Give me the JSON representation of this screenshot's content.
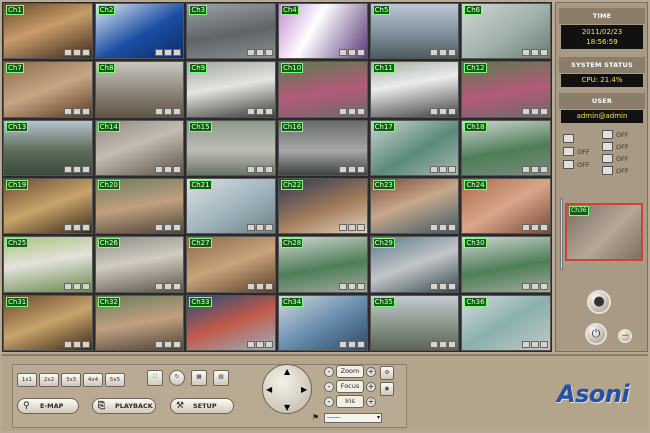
{
  "cameras": [
    {
      "label": "Ch1",
      "bg": "linear-gradient(160deg,#6a4a2a,#c99c6a 45%,#3b2a1a)"
    },
    {
      "label": "Ch2",
      "bg": "linear-gradient(150deg,#dfe8f0,#1b4ea3 55%,#0c2b66)"
    },
    {
      "label": "Ch3",
      "bg": "linear-gradient(170deg,#9aa0a5,#5f6467 55%,#8c8f92)"
    },
    {
      "label": "Ch4",
      "bg": "linear-gradient(120deg,#c58bd8,#ffffff 40%,#5b3a7a)"
    },
    {
      "label": "Ch5",
      "bg": "linear-gradient(180deg,#bcc6d4,#7b8a96 60%,#4e5a60)"
    },
    {
      "label": "Ch6",
      "bg": "linear-gradient(145deg,#cfd6d4,#9fb0aa 55%,#6b7d75)"
    },
    {
      "label": "Ch7",
      "bg": "linear-gradient(160deg,#8a6a4a,#c7a684 50%,#5a3b22)"
    },
    {
      "label": "Ch8",
      "bg": "linear-gradient(180deg,#c9c6bf,#8c8478 55%,#5f5547)"
    },
    {
      "label": "Ch9",
      "bg": "linear-gradient(170deg,#a2a6a0,#e4e4e0 45%,#3d3f3a)"
    },
    {
      "label": "Ch10",
      "bg": "linear-gradient(170deg,#5e7a4e,#b45a7a 55%,#6a6a6a)"
    },
    {
      "label": "Ch11",
      "bg": "linear-gradient(170deg,#a7aea4,#ececec 40%,#444)"
    },
    {
      "label": "Ch12",
      "bg": "linear-gradient(170deg,#5e7a4e,#b45a7a 55%,#6a6a6a)"
    },
    {
      "label": "Ch13",
      "bg": "linear-gradient(180deg,#b7c3cf,#5c6d5a 55%,#3c4a3b)"
    },
    {
      "label": "Ch14",
      "bg": "linear-gradient(160deg,#8e8a82,#c4bcb0 45%,#5b5248)"
    },
    {
      "label": "Ch15",
      "bg": "linear-gradient(180deg,#8c9a88,#bdbdb6 55%,#6a7266)"
    },
    {
      "label": "Ch16",
      "bg": "linear-gradient(180deg,#6a6d6b,#a5a8a6 55%,#3e4241)"
    },
    {
      "label": "Ch17",
      "bg": "linear-gradient(150deg,#c9d4d2,#5a8a7a 55%,#a8b4b0)"
    },
    {
      "label": "Ch18",
      "bg": "linear-gradient(170deg,#cfd5d0,#4e7e58 55%,#7a8a7e)"
    },
    {
      "label": "Ch19",
      "bg": "linear-gradient(160deg,#6a4a30,#c9a46b 50%,#3b2a1a)"
    },
    {
      "label": "Ch20",
      "bg": "linear-gradient(170deg,#6e7c5c,#c0a080 50%,#4d4438)"
    },
    {
      "label": "Ch21",
      "bg": "linear-gradient(150deg,#d9e0e4,#9fb2bb 55%,#6e7e84)"
    },
    {
      "label": "Ch22",
      "bg": "linear-gradient(160deg,#2f3a55,#a07a5a 55%,#e0d2b8)"
    },
    {
      "label": "Ch23",
      "bg": "linear-gradient(160deg,#7a4a3a,#c8a88a 45%,#3d5a6a)"
    },
    {
      "label": "Ch24",
      "bg": "linear-gradient(150deg,#a96b4a,#d9a68a 50%,#7a4a35)"
    },
    {
      "label": "Ch25",
      "bg": "linear-gradient(170deg,#a8c27a,#e2e2dc 45%,#6a8a4a)"
    },
    {
      "label": "Ch26",
      "bg": "linear-gradient(170deg,#8c8d86,#d2ccc0 45%,#5a534a)"
    },
    {
      "label": "Ch27",
      "bg": "linear-gradient(160deg,#8a6a4a,#c9a37b 50%,#5a4028)"
    },
    {
      "label": "Ch28",
      "bg": "linear-gradient(170deg,#cfd5d0,#4e7e58 55%,#a0a89a)"
    },
    {
      "label": "Ch29",
      "bg": "linear-gradient(160deg,#5a7a8a,#c2c6c8 50%,#3a4a52)"
    },
    {
      "label": "Ch30",
      "bg": "linear-gradient(170deg,#cfd5d0,#4e7e58 55%,#a0a89a)"
    },
    {
      "label": "Ch31",
      "bg": "linear-gradient(160deg,#6a4a30,#c9a46b 50%,#3b2a1a)"
    },
    {
      "label": "Ch32",
      "bg": "linear-gradient(170deg,#6e7c5c,#c0a080 50%,#4d4438)"
    },
    {
      "label": "Ch33",
      "bg": "linear-gradient(160deg,#2a4a7a,#c25a4a 50%,#9ab0c0)"
    },
    {
      "label": "Ch34",
      "bg": "linear-gradient(150deg,#cfd8dc,#6a8fb0 50%,#2f4a66)"
    },
    {
      "label": "Ch35",
      "bg": "linear-gradient(180deg,#c2cad2,#8a9486 55%,#5a6456)"
    },
    {
      "label": "Ch36",
      "bg": "linear-gradient(150deg,#d4dada,#8ab0ad 50%,#c0c8c6)"
    }
  ],
  "side": {
    "time_header": "TIME",
    "date": "2011/02/23",
    "time": "18:56:59",
    "status_header": "SYSTEM STATUS",
    "cpu": "CPU: 21.4%",
    "user_header": "USER",
    "user": "admin@admin",
    "status_items": [
      {
        "state": ""
      },
      {
        "state": "OFF"
      },
      {
        "state": "OFF"
      },
      {
        "state": "OFF"
      },
      {
        "state": "OFF"
      },
      {
        "state": "OFF"
      },
      {
        "state": "OFF"
      }
    ],
    "preview_label": "Ch36"
  },
  "bottom": {
    "layouts": [
      "1x1",
      "2x2",
      "3x3",
      "4x4",
      "5x5"
    ],
    "emap": "E-MAP",
    "playback": "PLAYBACK",
    "setup": "SETUP",
    "zoom": "Zoom",
    "focus": "Focus",
    "iris": "Iris",
    "preset_value": "------",
    "brand": "Asoni"
  },
  "colors": {
    "label_bg": "#0f5f0f",
    "label_border": "#7cfc7c",
    "panel": "#b7a994",
    "value_text": "#ffe13a"
  }
}
